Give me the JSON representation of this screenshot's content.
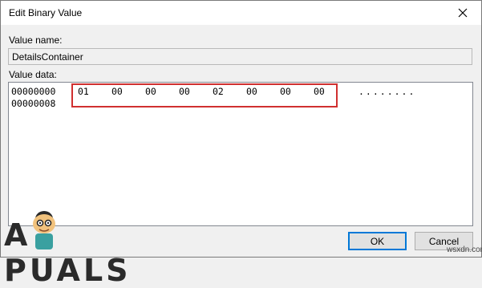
{
  "window": {
    "title": "Edit Binary Value"
  },
  "value_name": {
    "label": "Value name:",
    "value": "DetailsContainer"
  },
  "value_data": {
    "label": "Value data:",
    "rows": [
      {
        "address": "00000000",
        "bytes": [
          "01",
          "00",
          "00",
          "00",
          "02",
          "00",
          "00",
          "00"
        ],
        "ascii": "........"
      },
      {
        "address": "00000008",
        "bytes": [],
        "ascii": ""
      }
    ]
  },
  "buttons": {
    "ok": "OK",
    "cancel": "Cancel"
  },
  "watermarks": {
    "logo": "APPUALS",
    "site": "wsxdn.com"
  },
  "colors": {
    "highlight": "#d03030",
    "default_button_border": "#0078d7"
  },
  "icons": {
    "close": "close-icon",
    "logo": "appuals-mascot-icon"
  }
}
